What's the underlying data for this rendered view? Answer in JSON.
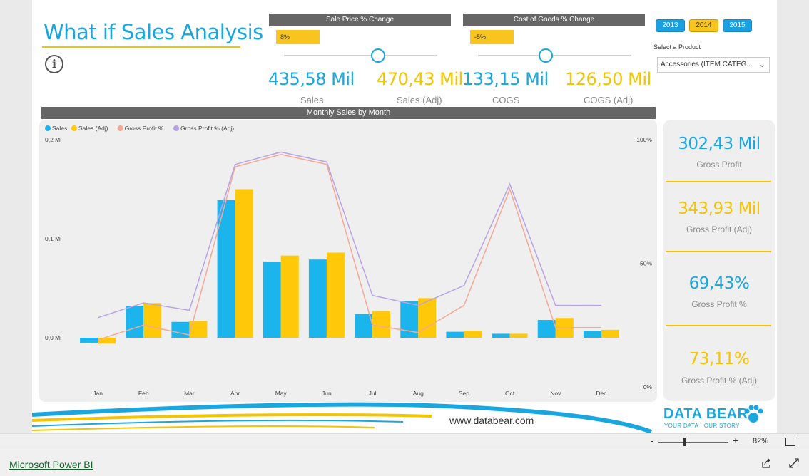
{
  "title": "What if Sales Analysis",
  "slicers": {
    "sale_price": {
      "label": "Sale Price % Change",
      "value": "8%"
    },
    "cogs": {
      "label": "Cost of Goods % Change",
      "value": "-5%"
    }
  },
  "cards": [
    {
      "value": "435,58 Mil",
      "label": "Sales"
    },
    {
      "value": "470,43 Mil",
      "label": "Sales (Adj)"
    },
    {
      "value": "133,15 Mil",
      "label": "COGS"
    },
    {
      "value": "126,50 Mil",
      "label": "COGS (Adj)"
    }
  ],
  "years": [
    "2013",
    "2014",
    "2015"
  ],
  "selected_year": "2014",
  "product": {
    "label": "Select a Product",
    "value": "Accessories (ITEM CATEG..."
  },
  "chart_header": "Monthly Sales by Month",
  "chart_data": {
    "type": "bar",
    "categories": [
      "Jan",
      "Feb",
      "Mar",
      "Apr",
      "May",
      "Jun",
      "Jul",
      "Aug",
      "Sep",
      "Oct",
      "Nov",
      "Dec"
    ],
    "series": [
      {
        "name": "Sales",
        "axis": "left",
        "kind": "bar",
        "color": "#1bb4ec",
        "values": [
          -0.005,
          0.032,
          0.016,
          0.139,
          0.077,
          0.079,
          0.024,
          0.037,
          0.006,
          0.004,
          0.018,
          0.007
        ]
      },
      {
        "name": "Sales (Adj)",
        "axis": "left",
        "kind": "bar",
        "color": "#ffc90a",
        "values": [
          -0.006,
          0.035,
          0.017,
          0.15,
          0.083,
          0.086,
          0.027,
          0.04,
          0.007,
          0.004,
          0.02,
          0.008
        ]
      },
      {
        "name": "Gross Profit %",
        "axis": "right",
        "kind": "line",
        "color": "#f4a896",
        "values": [
          19,
          25,
          21,
          89,
          94,
          90,
          25,
          22,
          33,
          80,
          24,
          24
        ]
      },
      {
        "name": "Gross Profit % (Adj)",
        "axis": "right",
        "kind": "line",
        "color": "#b8a4e4",
        "values": [
          28,
          34,
          31,
          90,
          95,
          91,
          37,
          33,
          41,
          82,
          33,
          33
        ]
      }
    ],
    "ylim_left": [
      -0.05,
      0.2
    ],
    "left_ticks": [
      {
        "v": 0.2,
        "label": "0,2 Mi"
      },
      {
        "v": 0.1,
        "label": "0,1 Mi"
      },
      {
        "v": 0.0,
        "label": "0,0 Mi"
      }
    ],
    "ylim_right": [
      0,
      100
    ],
    "right_ticks": [
      {
        "v": 100,
        "label": "100%"
      },
      {
        "v": 50,
        "label": "50%"
      },
      {
        "v": 0,
        "label": "0%"
      }
    ],
    "legend_position": "top-left",
    "grid": false
  },
  "kpis": [
    {
      "value": "302,43 Mil",
      "label": "Gross Profit",
      "color": "#1aa7e0"
    },
    {
      "value": "343,93 Mil",
      "label": "Gross Profit (Adj)",
      "color": "#f5c400"
    },
    {
      "value": "69,43%",
      "label": "Gross Profit %",
      "color": "#1aa7e0"
    },
    {
      "value": "73,11%",
      "label": "Gross Profit % (Adj)",
      "color": "#f5c400"
    }
  ],
  "footer": {
    "url": "www.databear.com",
    "logo": "DATA BEAR",
    "tagline": "YOUR DATA · OUR STORY"
  },
  "statusbar": {
    "zoom_minus": "-",
    "zoom_plus": "+",
    "zoom": "82%",
    "zoom_level": 0.37
  },
  "app": {
    "name": "Microsoft Power BI"
  }
}
